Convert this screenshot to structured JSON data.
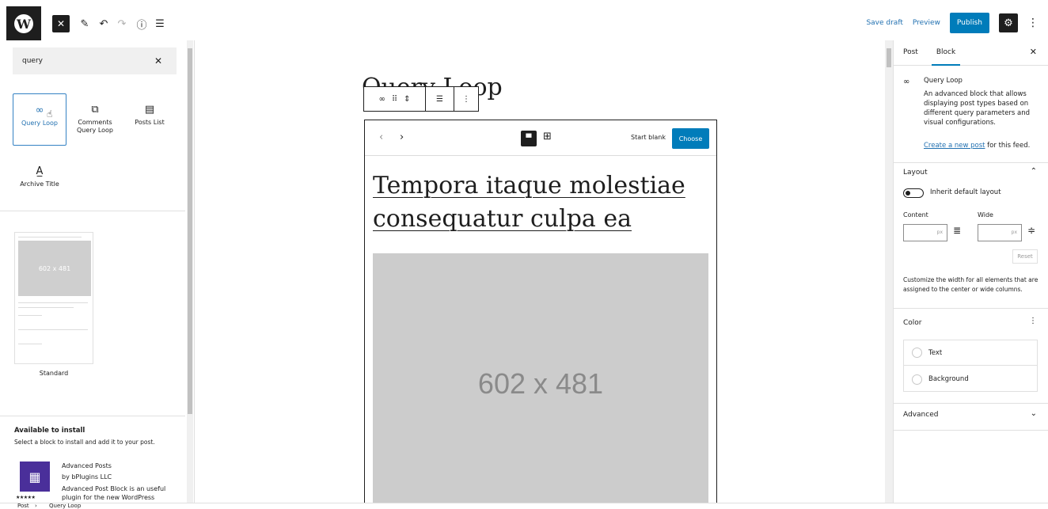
{
  "topbar": {
    "logo_letter": "W",
    "close_icon": "✕",
    "save_draft": "Save draft",
    "preview": "Preview",
    "publish": "Publish",
    "icons": [
      "pencil-icon",
      "undo-icon",
      "redo-icon",
      "info-icon",
      "list-view-icon",
      "gear-icon",
      "kebab-icon"
    ]
  },
  "inserter": {
    "search_value": "query",
    "blocks": [
      {
        "label": "Query Loop",
        "icon": "∞"
      },
      {
        "label": "Comments Query Loop",
        "icon": "⧉"
      },
      {
        "label": "Posts List",
        "icon": "▤"
      },
      {
        "label": "Archive Title",
        "icon": "A̲"
      }
    ],
    "pattern": {
      "label": "Standard",
      "placeholder": "602 x 481"
    },
    "available_title": "Available to install",
    "available_desc": "Select a block to install and add it to your post.",
    "plugin": {
      "name": "Advanced Posts",
      "by": "by bPlugins LLC",
      "desc": "Advanced Post Block is an useful plugin for the new WordPress",
      "stars": "★★★★★",
      "rating": 5
    }
  },
  "canvas": {
    "block_title": "Query Loop",
    "toolbar": {
      "icons": [
        "query-loop-icon",
        "drag-handle-icon",
        "move-arrows-icon",
        "align-icon",
        "more-options-icon"
      ]
    },
    "start_blank": "Start blank",
    "choose": "Choose",
    "post_title": "Tempora itaque molestiae consequatur culpa ea",
    "image_placeholder": "602 x 481"
  },
  "sidebar": {
    "tabs": [
      "Post",
      "Block"
    ],
    "active_tab": "Block",
    "block_name": "Query Loop",
    "block_desc": "An advanced block that allows displaying post types based on different query parameters and visual configurations.",
    "create_link": "Create a new post",
    "create_suffix": " for this feed.",
    "layout": {
      "title": "Layout",
      "toggle_label": "Inherit default layout",
      "toggle_on": false,
      "content_label": "Content",
      "wide_label": "Wide",
      "unit": "px",
      "reset": "Reset",
      "help": "Customize the width for all elements that are assigned to the center or wide columns."
    },
    "color": {
      "title": "Color",
      "items": [
        "Text",
        "Background"
      ]
    },
    "advanced": {
      "title": "Advanced"
    }
  },
  "breadcrumbs": [
    "Post",
    "Query Loop"
  ],
  "colors": {
    "accent": "#007cba",
    "link": "#2271b1",
    "dark": "#1e1e1e"
  }
}
